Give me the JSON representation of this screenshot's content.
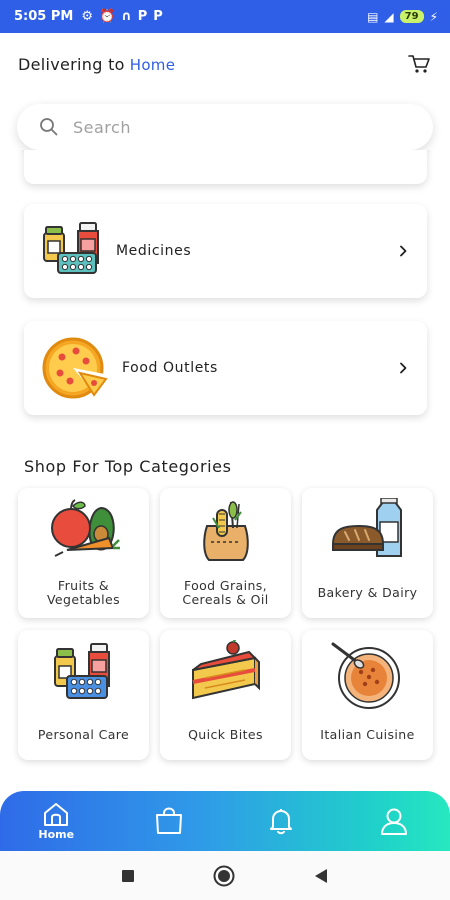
{
  "status_bar": {
    "time": "5:05 PM",
    "battery": "79"
  },
  "header": {
    "delivering_prefix": "Delivering to",
    "location": "Home"
  },
  "search": {
    "placeholder": "Search"
  },
  "services": [
    {
      "label": "Medicines",
      "icon": "medicines-icon"
    },
    {
      "label": "Food Outlets",
      "icon": "pizza-icon"
    }
  ],
  "section": {
    "title": "Shop For Top Categories"
  },
  "categories": [
    {
      "label": "Fruits & Vegetables",
      "line1": "Fruits &",
      "line2": "Vegetables",
      "icon": "fruits-vegetables-icon"
    },
    {
      "label": "Food Grains, Cereals & Oil",
      "line1": "Food Grains,",
      "line2": "Cereals & Oil",
      "icon": "grains-icon"
    },
    {
      "label": "Bakery & Dairy",
      "icon": "bakery-dairy-icon"
    },
    {
      "label": "Personal Care",
      "icon": "personal-care-icon"
    },
    {
      "label": "Quick Bites",
      "icon": "cake-icon"
    },
    {
      "label": "Italian Cuisine",
      "icon": "soup-bowl-icon"
    }
  ],
  "bottom_nav": [
    {
      "label": "Home",
      "icon": "home-icon",
      "active": true
    },
    {
      "label": "",
      "icon": "shopping-bag-icon"
    },
    {
      "label": "",
      "icon": "bell-icon"
    },
    {
      "label": "",
      "icon": "user-icon"
    }
  ],
  "colors": {
    "accent": "#2f5fe6",
    "nav_gradient_start": "#2f6be8",
    "nav_gradient_end": "#27e8c0"
  }
}
